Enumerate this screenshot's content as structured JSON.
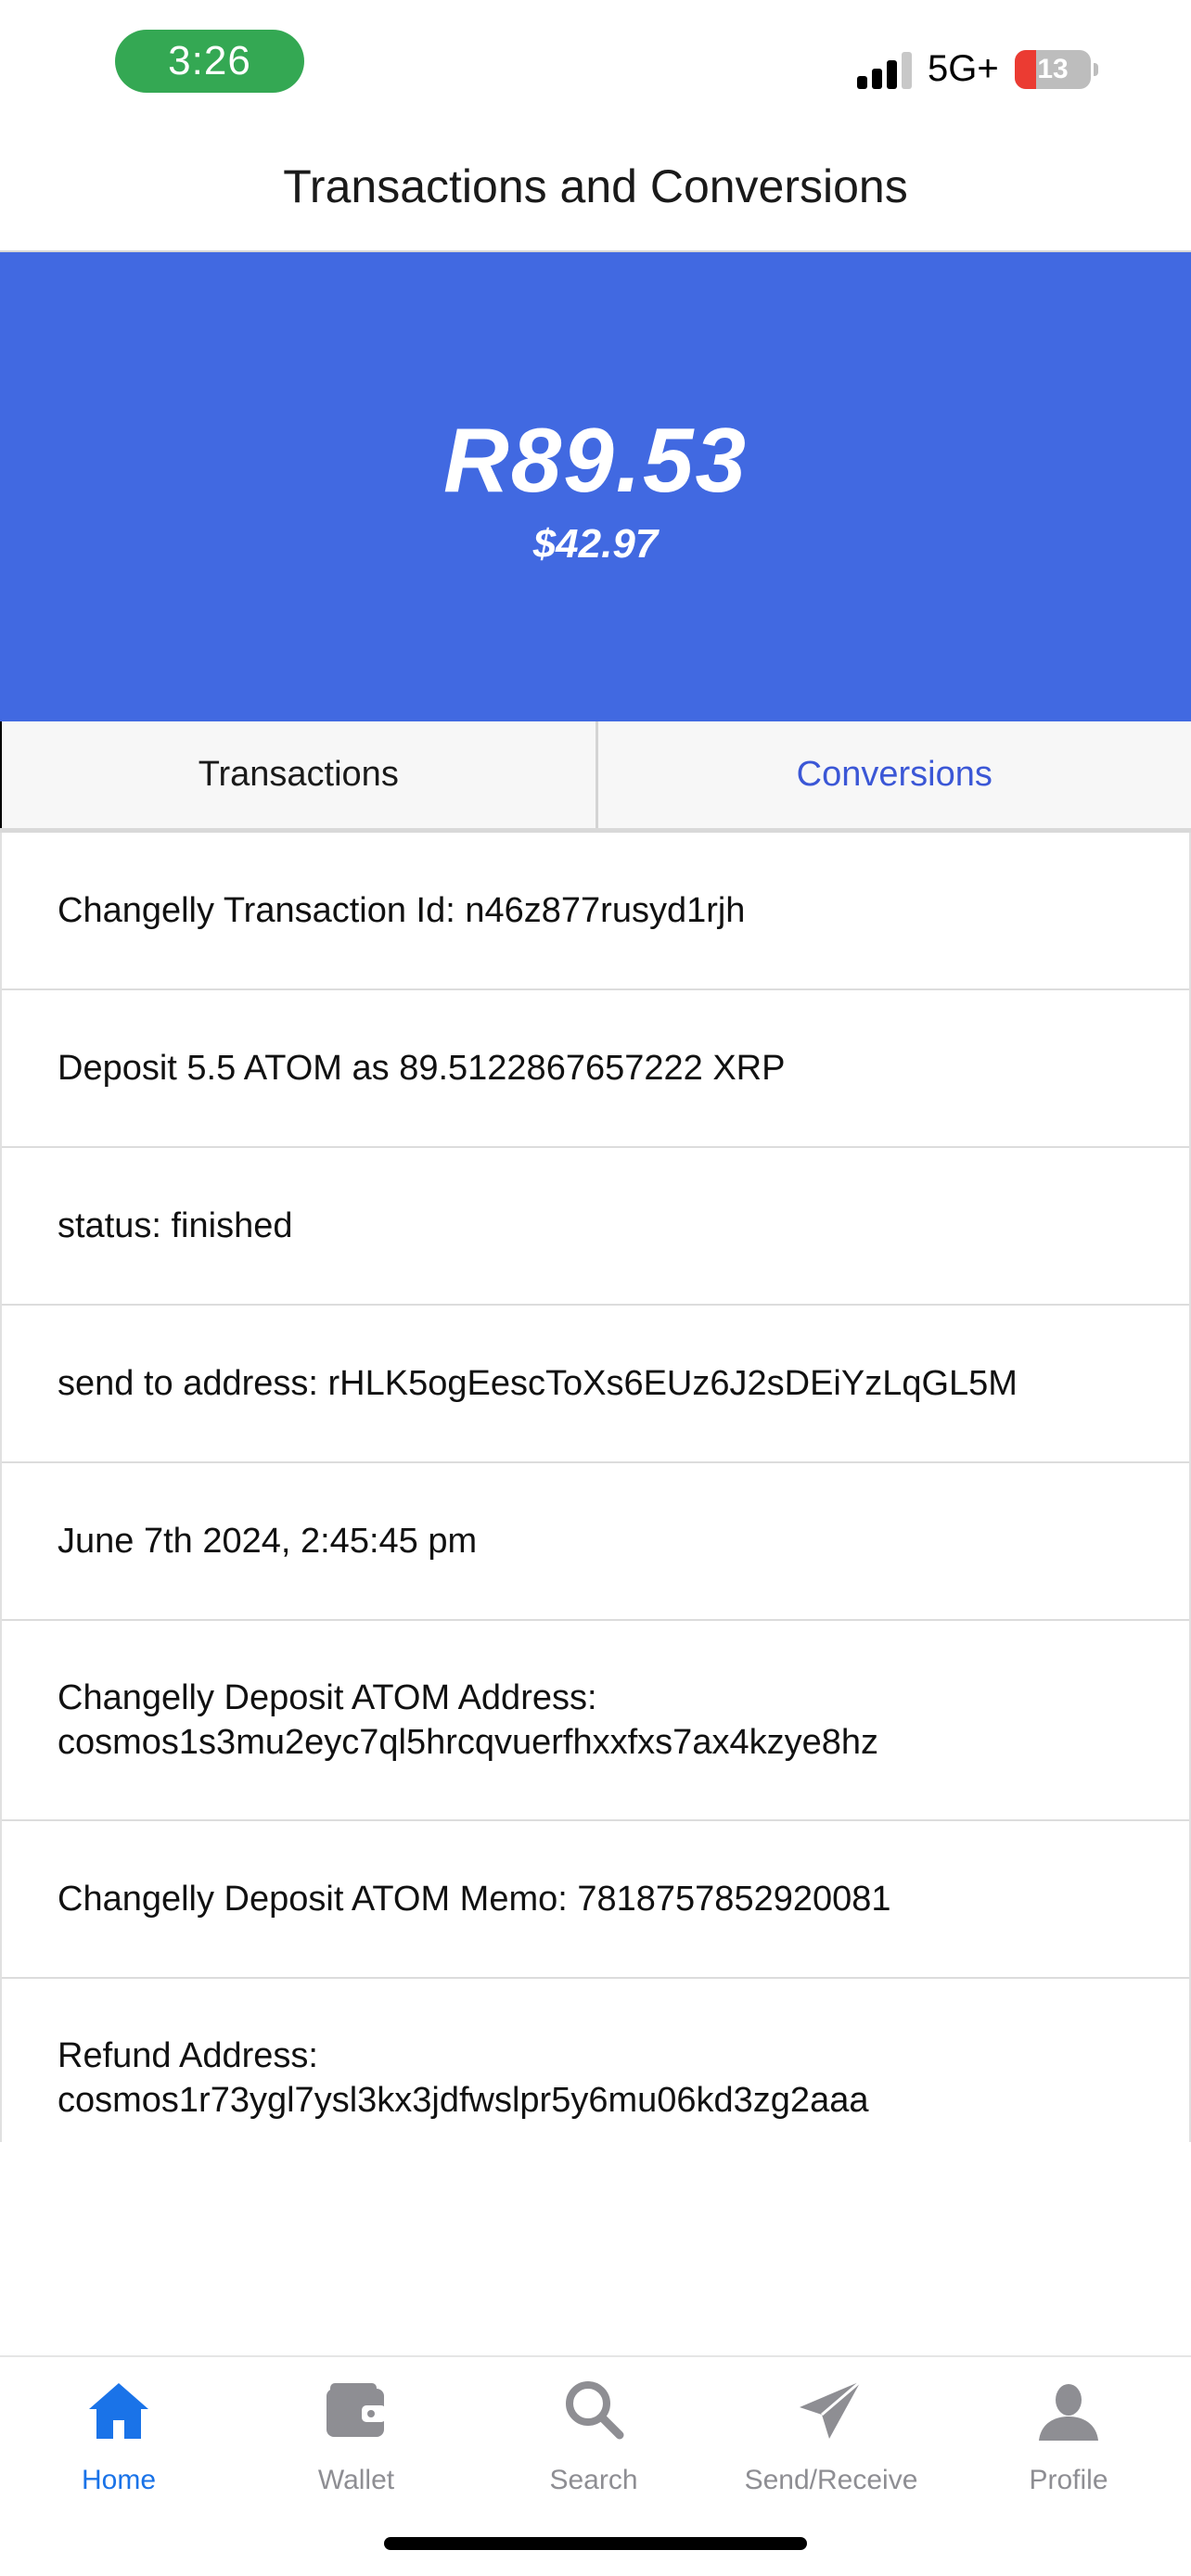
{
  "status_bar": {
    "time": "3:26",
    "network": "5G+",
    "battery_level": "13",
    "battery_percent": 13
  },
  "header": {
    "title": "Transactions and Conversions"
  },
  "balance": {
    "primary": "R89.53",
    "secondary": "$42.97"
  },
  "tabs": [
    {
      "label": "Transactions",
      "selected": true
    },
    {
      "label": "Conversions",
      "selected": false
    }
  ],
  "rows": [
    {
      "text": "Changelly Transaction Id: n46z877rusyd1rjh"
    },
    {
      "text": "Deposit 5.5 ATOM as 89.5122867657222 XRP"
    },
    {
      "text": "status: finished"
    },
    {
      "text": "send to address: rHLK5ogEescToXs6EUz6J2sDEiYzLqGL5M"
    },
    {
      "text": "June 7th 2024, 2:45:45 pm"
    },
    {
      "text": "Changelly Deposit ATOM Address:\ncosmos1s3mu2eyc7ql5hrcqvuerfhxxfxs7ax4kzye8hz"
    },
    {
      "text": "Changelly Deposit ATOM Memo: 7818757852920081"
    },
    {
      "text": "Refund Address:\ncosmos1r73ygl7ysl3kx3jdfwslpr5y6mu06kd3zg2aaa"
    }
  ],
  "bottom_nav": [
    {
      "label": "Home",
      "icon": "home-icon",
      "active": true
    },
    {
      "label": "Wallet",
      "icon": "wallet-icon",
      "active": false
    },
    {
      "label": "Search",
      "icon": "search-icon",
      "active": false
    },
    {
      "label": "Send/Receive",
      "icon": "send-icon",
      "active": false
    },
    {
      "label": "Profile",
      "icon": "profile-icon",
      "active": false
    }
  ],
  "colors": {
    "banner": "#4169e1",
    "active_tab_text": "#3b57d6",
    "nav_active": "#1a73e8",
    "nav_inactive": "#8e8e93",
    "time_pill": "#34a853",
    "battery_low": "#eb3b32"
  }
}
